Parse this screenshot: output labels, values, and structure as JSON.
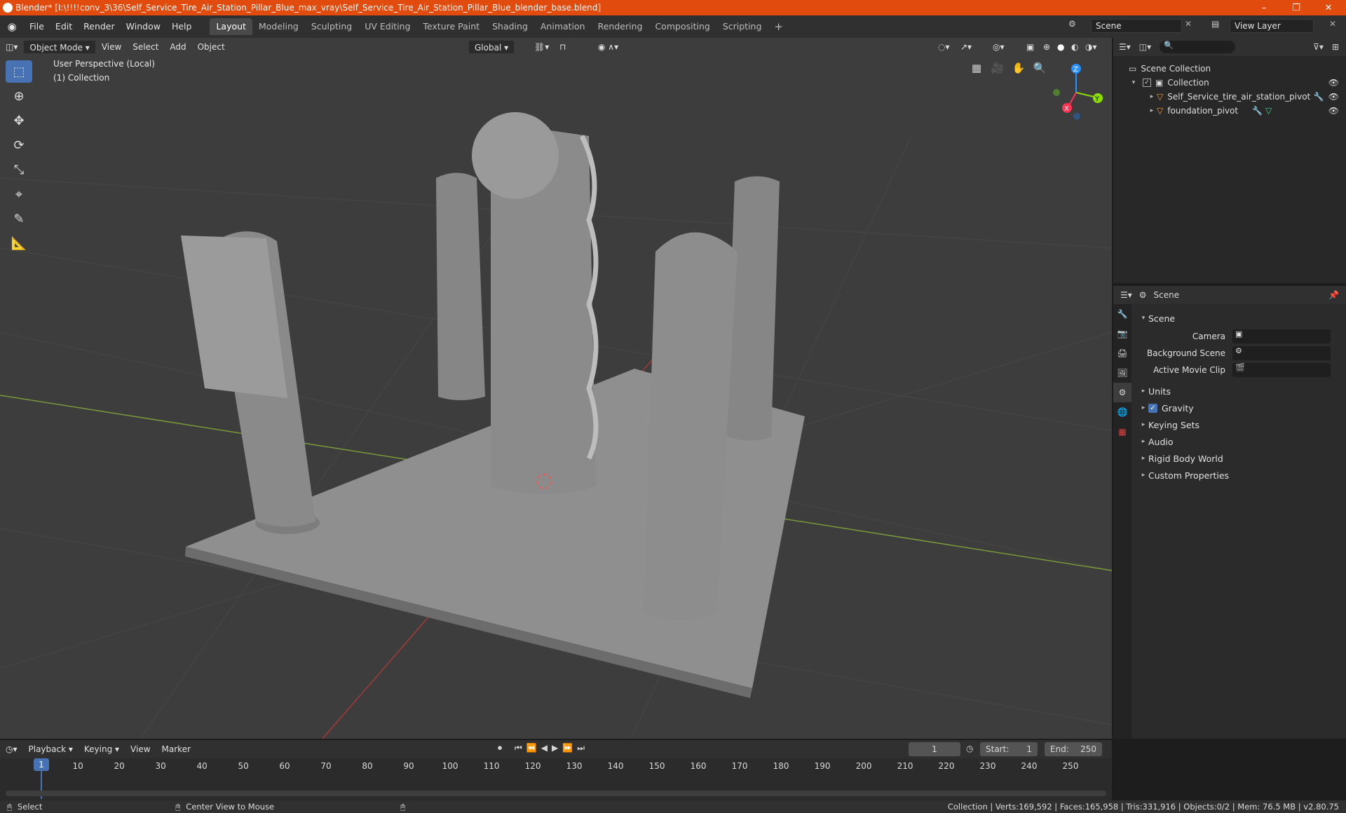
{
  "window": {
    "title": "Blender* [I:\\!!!!conv_3\\36\\Self_Service_Tire_Air_Station_Pillar_Blue_max_vray\\Self_Service_Tire_Air_Station_Pillar_Blue_blender_base.blend]",
    "controls": [
      "–",
      "❐",
      "✕"
    ]
  },
  "menu": [
    "File",
    "Edit",
    "Render",
    "Window",
    "Help"
  ],
  "workspaces": [
    "Layout",
    "Modeling",
    "Sculpting",
    "UV Editing",
    "Texture Paint",
    "Shading",
    "Animation",
    "Rendering",
    "Compositing",
    "Scripting"
  ],
  "active_workspace": "Layout",
  "scene_field": "Scene",
  "view_layer_field": "View Layer",
  "viewport": {
    "mode": "Object Mode",
    "menus": [
      "View",
      "Select",
      "Add",
      "Object"
    ],
    "orientation": "Global",
    "overlay_title": "User Perspective (Local)",
    "overlay_sub": "(1) Collection",
    "gizmo_axes": {
      "x": "X",
      "y": "Y",
      "z": "Z"
    }
  },
  "outliner": {
    "root": "Scene Collection",
    "collection": "Collection",
    "items": [
      "Self_Service_tire_air_station_pivot",
      "foundation_pivot"
    ]
  },
  "properties": {
    "header": "Scene",
    "panel": "Scene",
    "fields": {
      "camera": "Camera",
      "background_scene": "Background Scene",
      "active_movie_clip": "Active Movie Clip"
    },
    "subpanels": [
      "Units",
      "Gravity",
      "Keying Sets",
      "Audio",
      "Rigid Body World",
      "Custom Properties"
    ],
    "gravity_checked": true
  },
  "timeline": {
    "menus": [
      "Playback",
      "Keying",
      "View",
      "Marker"
    ],
    "current_frame": "1",
    "start_label": "Start:",
    "start": "1",
    "end_label": "End:",
    "end": "250",
    "ticks": [
      "10",
      "20",
      "30",
      "40",
      "50",
      "60",
      "70",
      "80",
      "90",
      "100",
      "110",
      "120",
      "130",
      "140",
      "150",
      "160",
      "170",
      "180",
      "190",
      "200",
      "210",
      "220",
      "230",
      "240",
      "250"
    ],
    "playhead_label": "1"
  },
  "status": {
    "left": "Select",
    "middle": "Center View to Mouse",
    "right": "Collection | Verts:169,592 | Faces:165,958 | Tris:331,916 | Objects:0/2 | Mem: 76.5 MB | v2.80.75"
  },
  "colors": {
    "accent": "#4772b3",
    "titlebar": "#e14b0e",
    "x_axis": "#ff3352",
    "y_axis": "#8bdc00",
    "z_axis": "#2890ff"
  }
}
